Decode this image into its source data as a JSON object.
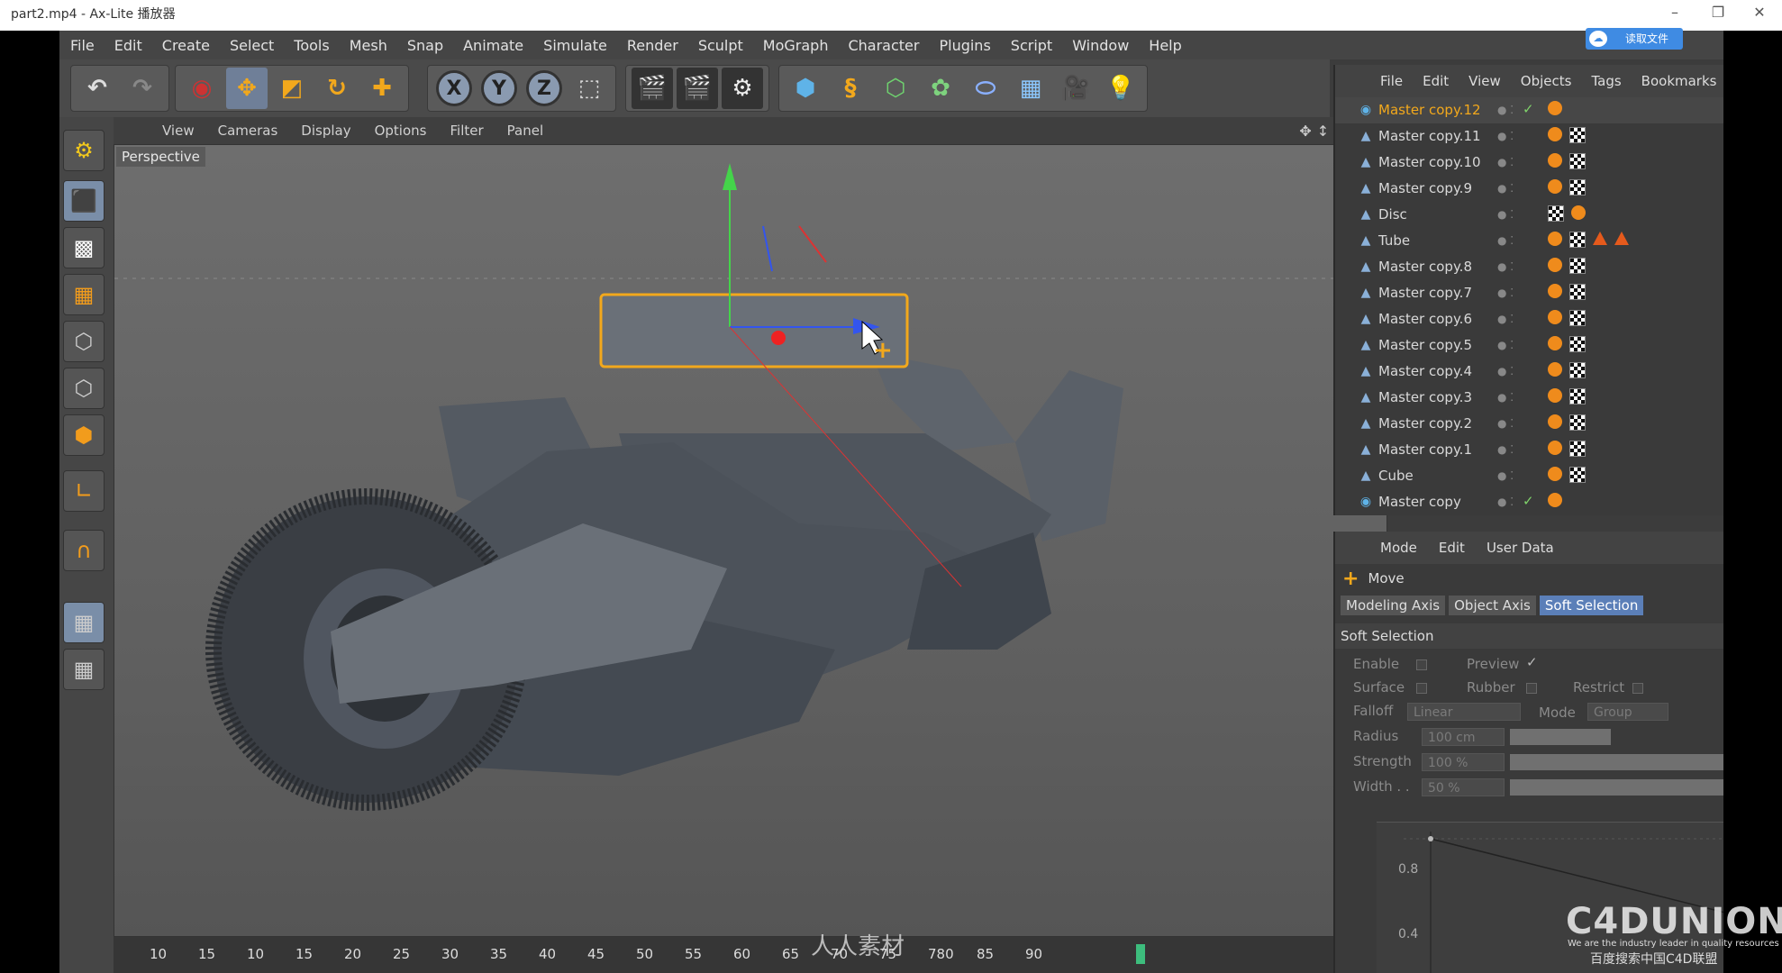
{
  "player": {
    "title": "part2.mp4 - Ax-Lite 播放器",
    "cloud_button": "读取文件",
    "min": "–",
    "max": "❐",
    "close": "✕"
  },
  "menu": [
    "File",
    "Edit",
    "Create",
    "Select",
    "Tools",
    "Mesh",
    "Snap",
    "Animate",
    "Simulate",
    "Render",
    "Sculpt",
    "MoGraph",
    "Character",
    "Plugins",
    "Script",
    "Window",
    "Help"
  ],
  "viewport": {
    "menu": [
      "View",
      "Cameras",
      "Display",
      "Options",
      "Filter",
      "Panel"
    ],
    "label": "Perspective"
  },
  "timeline": {
    "ticks": [
      "10",
      "15",
      "10",
      "15",
      "20",
      "25",
      "30",
      "35",
      "40",
      "45",
      "50",
      "55",
      "60",
      "65",
      "70",
      "75",
      "780",
      "85",
      "90"
    ]
  },
  "object_manager": {
    "menu": [
      "File",
      "Edit",
      "View",
      "Objects",
      "Tags",
      "Bookmarks"
    ],
    "objects": [
      {
        "name": "Master copy.12",
        "icon": "null-object-icon",
        "selected": true,
        "tags": "ph",
        "check": true
      },
      {
        "name": "Master copy.11",
        "icon": "polygon-object-icon",
        "tags": "ph-chk"
      },
      {
        "name": "Master copy.10",
        "icon": "polygon-object-icon",
        "tags": "ph-chk"
      },
      {
        "name": "Master copy.9",
        "icon": "polygon-object-icon",
        "tags": "ph-chk"
      },
      {
        "name": "Disc",
        "icon": "polygon-object-icon",
        "tags": "chk-ph"
      },
      {
        "name": "Tube",
        "icon": "polygon-object-icon",
        "tags": "ph-chk-tri"
      },
      {
        "name": "Master copy.8",
        "icon": "polygon-object-icon",
        "tags": "ph-chk"
      },
      {
        "name": "Master copy.7",
        "icon": "polygon-object-icon",
        "tags": "ph-chk"
      },
      {
        "name": "Master copy.6",
        "icon": "polygon-object-icon",
        "tags": "ph-chk"
      },
      {
        "name": "Master copy.5",
        "icon": "polygon-object-icon",
        "tags": "ph-chk"
      },
      {
        "name": "Master copy.4",
        "icon": "polygon-object-icon",
        "tags": "ph-chk"
      },
      {
        "name": "Master copy.3",
        "icon": "polygon-object-icon",
        "tags": "ph-chk"
      },
      {
        "name": "Master copy.2",
        "icon": "polygon-object-icon",
        "tags": "ph-chk"
      },
      {
        "name": "Master copy.1",
        "icon": "polygon-object-icon",
        "tags": "ph-chk"
      },
      {
        "name": "Cube",
        "icon": "polygon-object-icon",
        "tags": "ph-chk"
      },
      {
        "name": "Master copy",
        "icon": "null-object-icon",
        "tags": "ph",
        "check": true
      }
    ]
  },
  "attributes": {
    "menu": [
      "Mode",
      "Edit",
      "User Data"
    ],
    "tool": "Move",
    "tabs": [
      "Modeling Axis",
      "Object Axis",
      "Soft Selection"
    ],
    "active_tab": "Soft Selection",
    "section": "Soft Selection",
    "labels": {
      "enable": "Enable",
      "preview": "Preview",
      "surface": "Surface",
      "rubber": "Rubber",
      "restrict": "Restrict",
      "falloff": "Falloff",
      "mode": "Mode",
      "radius": "Radius",
      "strength": "Strength",
      "width": "Width . ."
    },
    "values": {
      "falloff": "Linear",
      "mode": "Group",
      "radius": "100 cm",
      "strength": "100 %",
      "width": "50 %",
      "preview_check": "✓"
    },
    "graph_labels": [
      "0.8",
      "0.4"
    ]
  },
  "watermark": {
    "brand": "C4DUNION",
    "tagline": "We are the industry leader in quality resources",
    "cn": "百度搜索中国C4D联盟",
    "center": "人人素材"
  }
}
